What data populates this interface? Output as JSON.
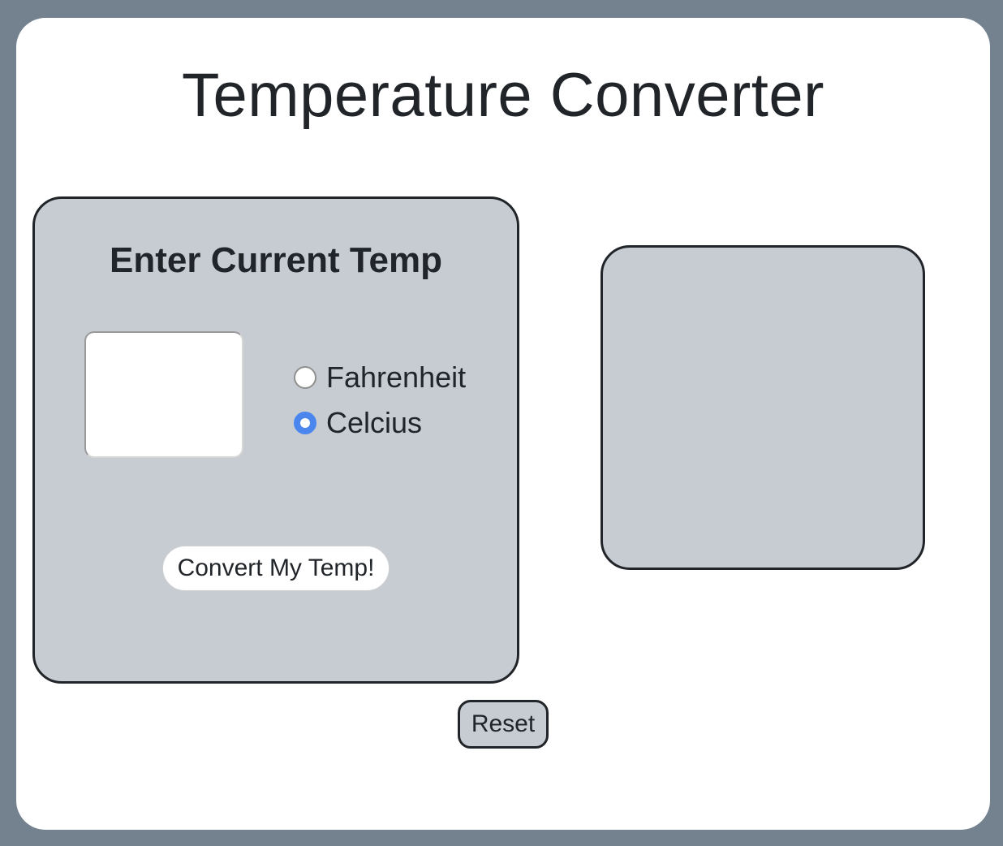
{
  "page": {
    "title": "Temperature Converter"
  },
  "input_panel": {
    "heading": "Enter Current Temp",
    "temperature_input": {
      "value": "",
      "placeholder": ""
    },
    "units": [
      {
        "label": "Fahrenheit",
        "selected": false
      },
      {
        "label": "Celcius",
        "selected": true
      }
    ],
    "convert_label": "Convert My Temp!"
  },
  "result_panel": {
    "text": ""
  },
  "reset_label": "Reset",
  "colors": {
    "backdrop": "#748290",
    "card": "#ffffff",
    "panel": "#c7ccd3",
    "border": "#212529",
    "radio_selected": "#4b86ee",
    "text": "#212529"
  }
}
